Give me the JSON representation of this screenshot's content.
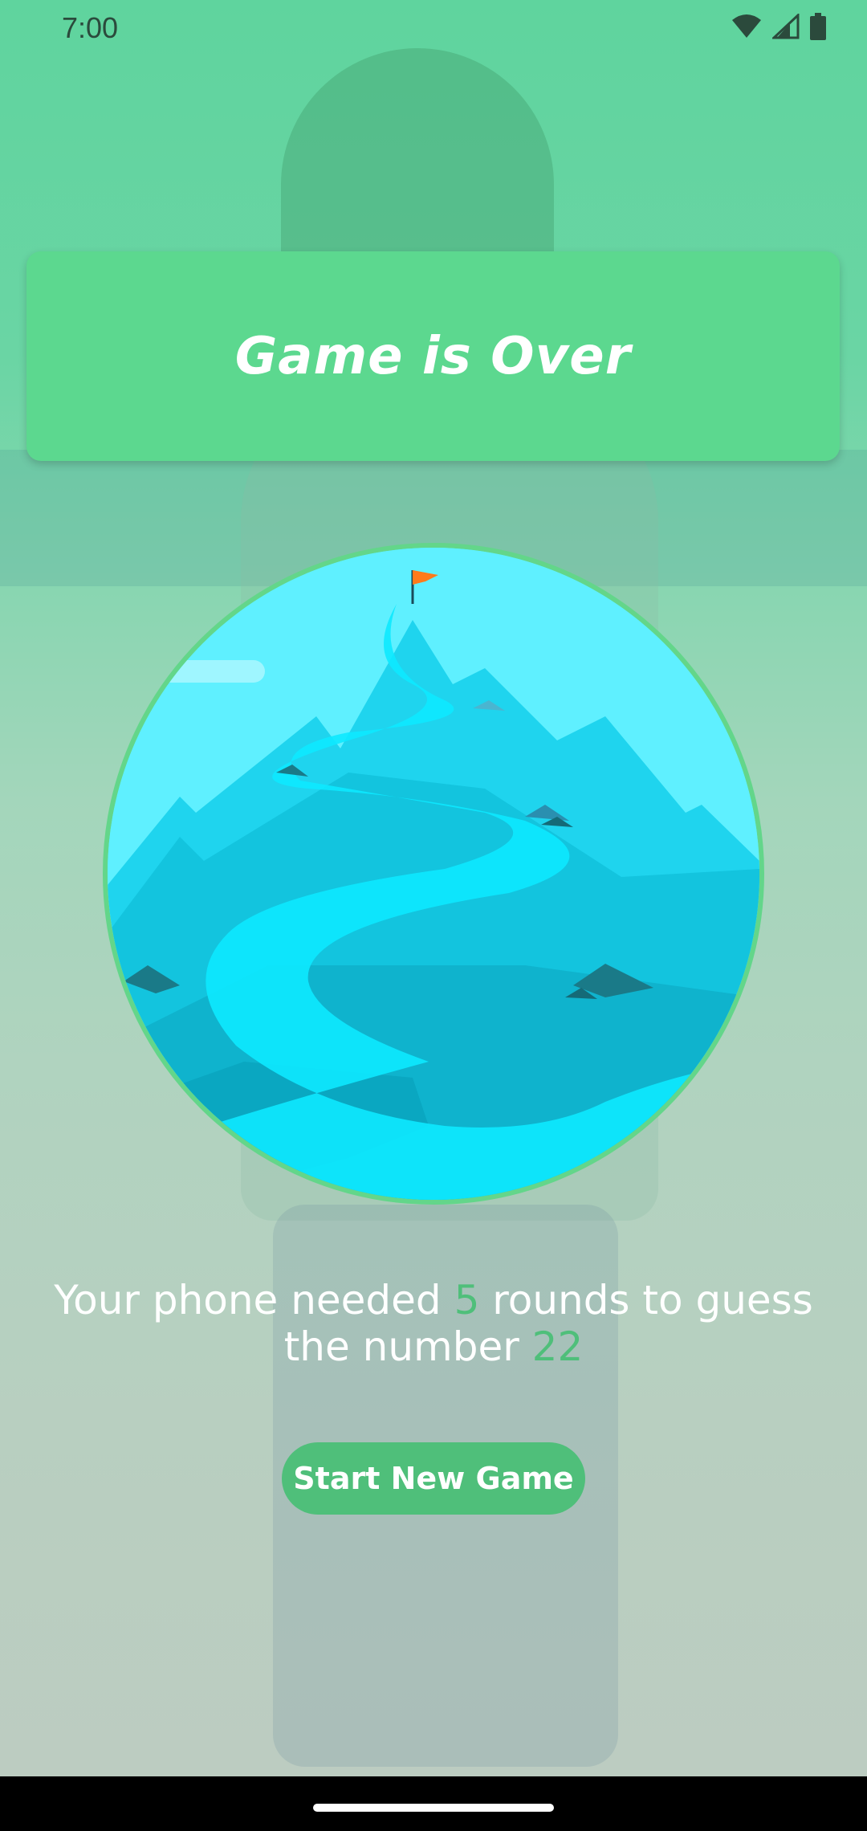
{
  "status_bar": {
    "time": "7:00",
    "icons": [
      "wifi-icon",
      "signal-icon",
      "battery-icon"
    ]
  },
  "header": {
    "title": "Game is Over"
  },
  "image": {
    "description_icon": "mountain-illustration"
  },
  "result": {
    "prefix": "Your phone needed ",
    "rounds": "5",
    "middle": " rounds to guess the number ",
    "number": "22"
  },
  "actions": {
    "start_new_game_label": "Start New Game"
  },
  "colors": {
    "primary_green": "#5cd88f",
    "accent_green": "#4fbf7a",
    "circle_border": "#63d68a",
    "sky": "#5ff0ff"
  }
}
